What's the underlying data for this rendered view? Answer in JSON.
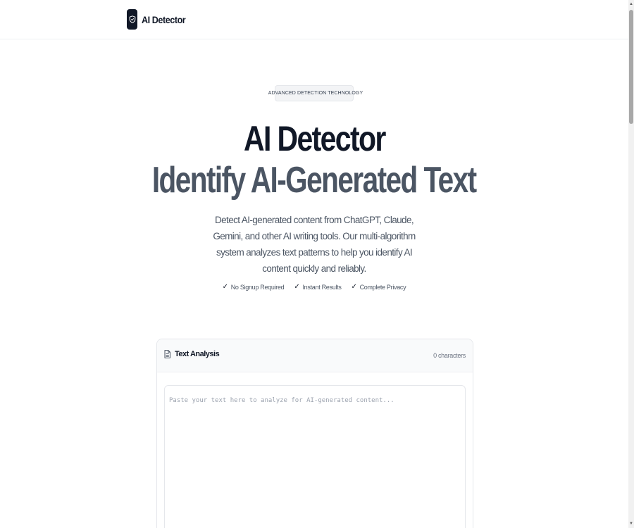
{
  "header": {
    "brand_name": "AI Detector",
    "logo_icon": "shield-check-icon"
  },
  "hero": {
    "badge": "ADVANCED DETECTION TECHNOLOGY",
    "title_line1": "AI Detector",
    "title_line2": "Identify AI-Generated Text",
    "description": "Detect AI-generated content from ChatGPT, Claude, Gemini, and other AI writing tools. Our multi-algorithm system analyzes text patterns to help you identify AI content quickly and reliably.",
    "features": [
      {
        "label": "No Signup Required",
        "icon": "check-icon"
      },
      {
        "label": "Instant Results",
        "icon": "check-icon"
      },
      {
        "label": "Complete Privacy",
        "icon": "check-icon"
      }
    ]
  },
  "analysis": {
    "title": "Text Analysis",
    "title_icon": "document-icon",
    "char_count": "0 characters",
    "input_value": "",
    "input_placeholder": "Paste your text here to analyze for AI-generated content..."
  },
  "colors": {
    "primary": "#111827",
    "secondary_title": "#4b5563",
    "badge_dot": "#3b82f6",
    "badge_bg": "#f3f4f6"
  }
}
